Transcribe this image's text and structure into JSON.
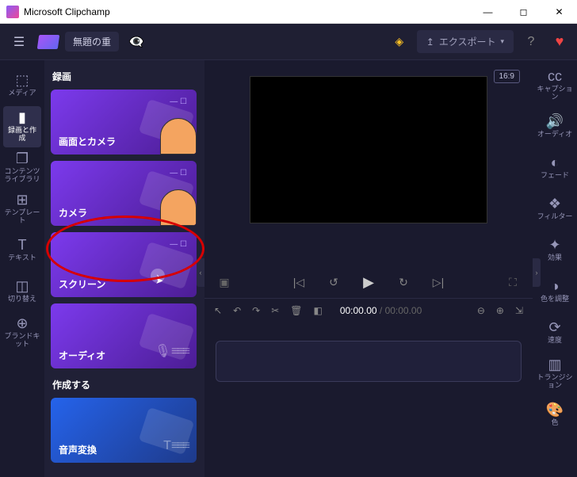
{
  "window": {
    "title": "Microsoft Clipchamp"
  },
  "header": {
    "project_name": "無題の重",
    "export_label": "エクスポート"
  },
  "toolrail": {
    "items": [
      {
        "id": "media",
        "label": "メディア",
        "icon": "⬚"
      },
      {
        "id": "record",
        "label": "録画と作成",
        "icon": "■"
      },
      {
        "id": "library",
        "label": "コンテンツライブラリ",
        "icon": "❐"
      },
      {
        "id": "template",
        "label": "テンプレート",
        "icon": "⊞"
      },
      {
        "id": "text",
        "label": "テキスト",
        "icon": "T"
      },
      {
        "id": "trans",
        "label": "切り替え",
        "icon": "◫"
      },
      {
        "id": "brand",
        "label": "ブランドキット",
        "icon": "⊕"
      }
    ]
  },
  "panel": {
    "sections": [
      {
        "title": "録画",
        "cards": [
          {
            "id": "screen-camera",
            "label": "画面とカメラ"
          },
          {
            "id": "camera",
            "label": "カメラ"
          },
          {
            "id": "screen",
            "label": "スクリーン"
          },
          {
            "id": "audio",
            "label": "オーディオ"
          }
        ]
      },
      {
        "title": "作成する",
        "cards": [
          {
            "id": "tts",
            "label": "音声変換"
          }
        ]
      }
    ]
  },
  "preview": {
    "aspect": "16:9"
  },
  "timeline": {
    "current": "00:00.00",
    "total": "00:00.00"
  },
  "proprail": {
    "items": [
      {
        "id": "caption",
        "label": "キャプション",
        "icon": "cc"
      },
      {
        "id": "audio",
        "label": "オーディオ",
        "icon": "◉"
      },
      {
        "id": "fade",
        "label": "フェード",
        "icon": "◐"
      },
      {
        "id": "filter",
        "label": "フィルター",
        "icon": "❖"
      },
      {
        "id": "effect",
        "label": "効果",
        "icon": "✦"
      },
      {
        "id": "color",
        "label": "色を調整",
        "icon": "◑"
      },
      {
        "id": "speed",
        "label": "速度",
        "icon": "⟳"
      },
      {
        "id": "transition",
        "label": "トランジション",
        "icon": "▥"
      },
      {
        "id": "colorpick",
        "label": "色",
        "icon": "🎨"
      }
    ]
  }
}
